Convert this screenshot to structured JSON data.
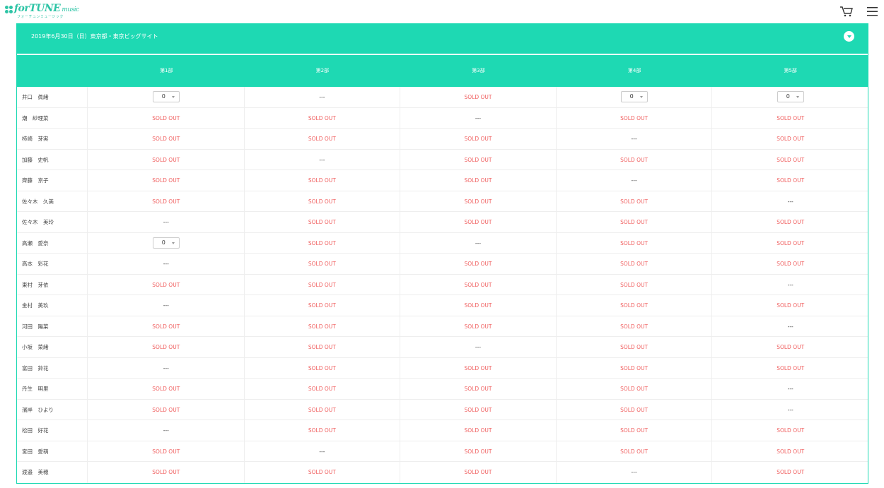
{
  "header": {
    "logo_main": "forTUNE",
    "logo_music": "music",
    "logo_sub": "フォーチュンミュージック",
    "brand_color": "#2ec4a6",
    "cart_icon": "cart-icon",
    "menu_icon": "hamburger-menu-icon"
  },
  "event": {
    "date_label": "2019年6月30日（日）東京都・東京ビッグサイト",
    "accent_color": "#1ed9b3",
    "columns": [
      "第1部",
      "第2部",
      "第3部",
      "第4部",
      "第5部"
    ]
  },
  "labels": {
    "sold_out": "SOLD OUT",
    "unavailable": "---",
    "select_default": "0"
  },
  "members": [
    {
      "name": "井口　眞緒",
      "slots": [
        "select",
        "dash",
        "sold",
        "select",
        "select"
      ]
    },
    {
      "name": "潮　紗理菜",
      "slots": [
        "sold",
        "sold",
        "dash",
        "sold",
        "sold"
      ]
    },
    {
      "name": "柿崎　芽実",
      "slots": [
        "sold",
        "sold",
        "sold",
        "dash",
        "sold"
      ]
    },
    {
      "name": "加藤　史帆",
      "slots": [
        "sold",
        "dash",
        "sold",
        "sold",
        "sold"
      ]
    },
    {
      "name": "齊藤　京子",
      "slots": [
        "sold",
        "sold",
        "sold",
        "dash",
        "sold"
      ]
    },
    {
      "name": "佐々木　久美",
      "slots": [
        "sold",
        "sold",
        "sold",
        "sold",
        "dash"
      ]
    },
    {
      "name": "佐々木　美玲",
      "slots": [
        "dash",
        "sold",
        "sold",
        "sold",
        "sold"
      ]
    },
    {
      "name": "高瀬　愛奈",
      "slots": [
        "select",
        "sold",
        "dash",
        "sold",
        "sold"
      ]
    },
    {
      "name": "高本　彩花",
      "slots": [
        "dash",
        "sold",
        "sold",
        "sold",
        "sold"
      ]
    },
    {
      "name": "東村　芽依",
      "slots": [
        "sold",
        "sold",
        "sold",
        "sold",
        "dash"
      ]
    },
    {
      "name": "金村　美玖",
      "slots": [
        "dash",
        "sold",
        "sold",
        "sold",
        "sold"
      ]
    },
    {
      "name": "河田　陽菜",
      "slots": [
        "sold",
        "sold",
        "sold",
        "sold",
        "dash"
      ]
    },
    {
      "name": "小坂　菜緒",
      "slots": [
        "sold",
        "sold",
        "dash",
        "sold",
        "sold"
      ]
    },
    {
      "name": "富田　鈴花",
      "slots": [
        "dash",
        "sold",
        "sold",
        "sold",
        "sold"
      ]
    },
    {
      "name": "丹生　明里",
      "slots": [
        "sold",
        "sold",
        "sold",
        "sold",
        "dash"
      ]
    },
    {
      "name": "濱岸　ひより",
      "slots": [
        "sold",
        "sold",
        "sold",
        "sold",
        "dash"
      ]
    },
    {
      "name": "松田　好花",
      "slots": [
        "dash",
        "sold",
        "sold",
        "sold",
        "sold"
      ]
    },
    {
      "name": "宮田　愛萌",
      "slots": [
        "sold",
        "dash",
        "sold",
        "sold",
        "sold"
      ]
    },
    {
      "name": "渡邉　美穂",
      "slots": [
        "sold",
        "sold",
        "sold",
        "dash",
        "sold"
      ]
    }
  ]
}
